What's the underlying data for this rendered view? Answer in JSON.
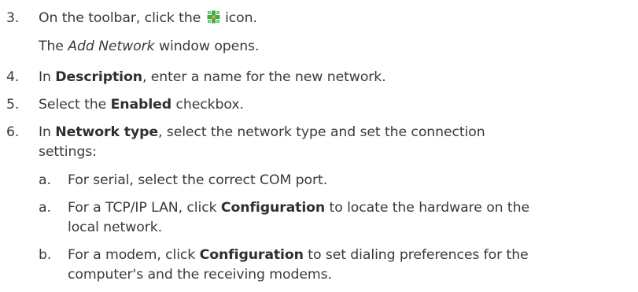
{
  "steps": [
    {
      "number": "3.",
      "text_before_icon": "On the toolbar, click the",
      "icon": "add-network-icon",
      "text_after_icon": "icon.",
      "result_pre": "The",
      "result_em": "Add Network",
      "result_post": "window opens."
    },
    {
      "number": "4.",
      "pre": "In",
      "bold": "Description",
      "post": ", enter a name for the new network."
    },
    {
      "number": "5.",
      "pre": "Select the",
      "bold": "Enabled",
      "post": "checkbox."
    },
    {
      "number": "6.",
      "pre": "In",
      "bold": "Network type",
      "post": ", select the network type and set the connection",
      "line2": "settings:",
      "substeps": [
        {
          "letter": "a.",
          "text": "For serial, select the correct COM port."
        },
        {
          "letter": "a.",
          "pre": "For a TCP/IP LAN, click",
          "bold": "Configuration",
          "post": "to locate the hardware on the",
          "line2": "local network."
        },
        {
          "letter": "b.",
          "pre": "For a modem, click",
          "bold": "Configuration",
          "post": "to set dialing preferences for the",
          "line2": "computer's and the receiving modems."
        }
      ]
    }
  ],
  "colors": {
    "text": "#3a3a3a",
    "icon_green": "#3cb043",
    "icon_orange": "#e8a33a"
  }
}
